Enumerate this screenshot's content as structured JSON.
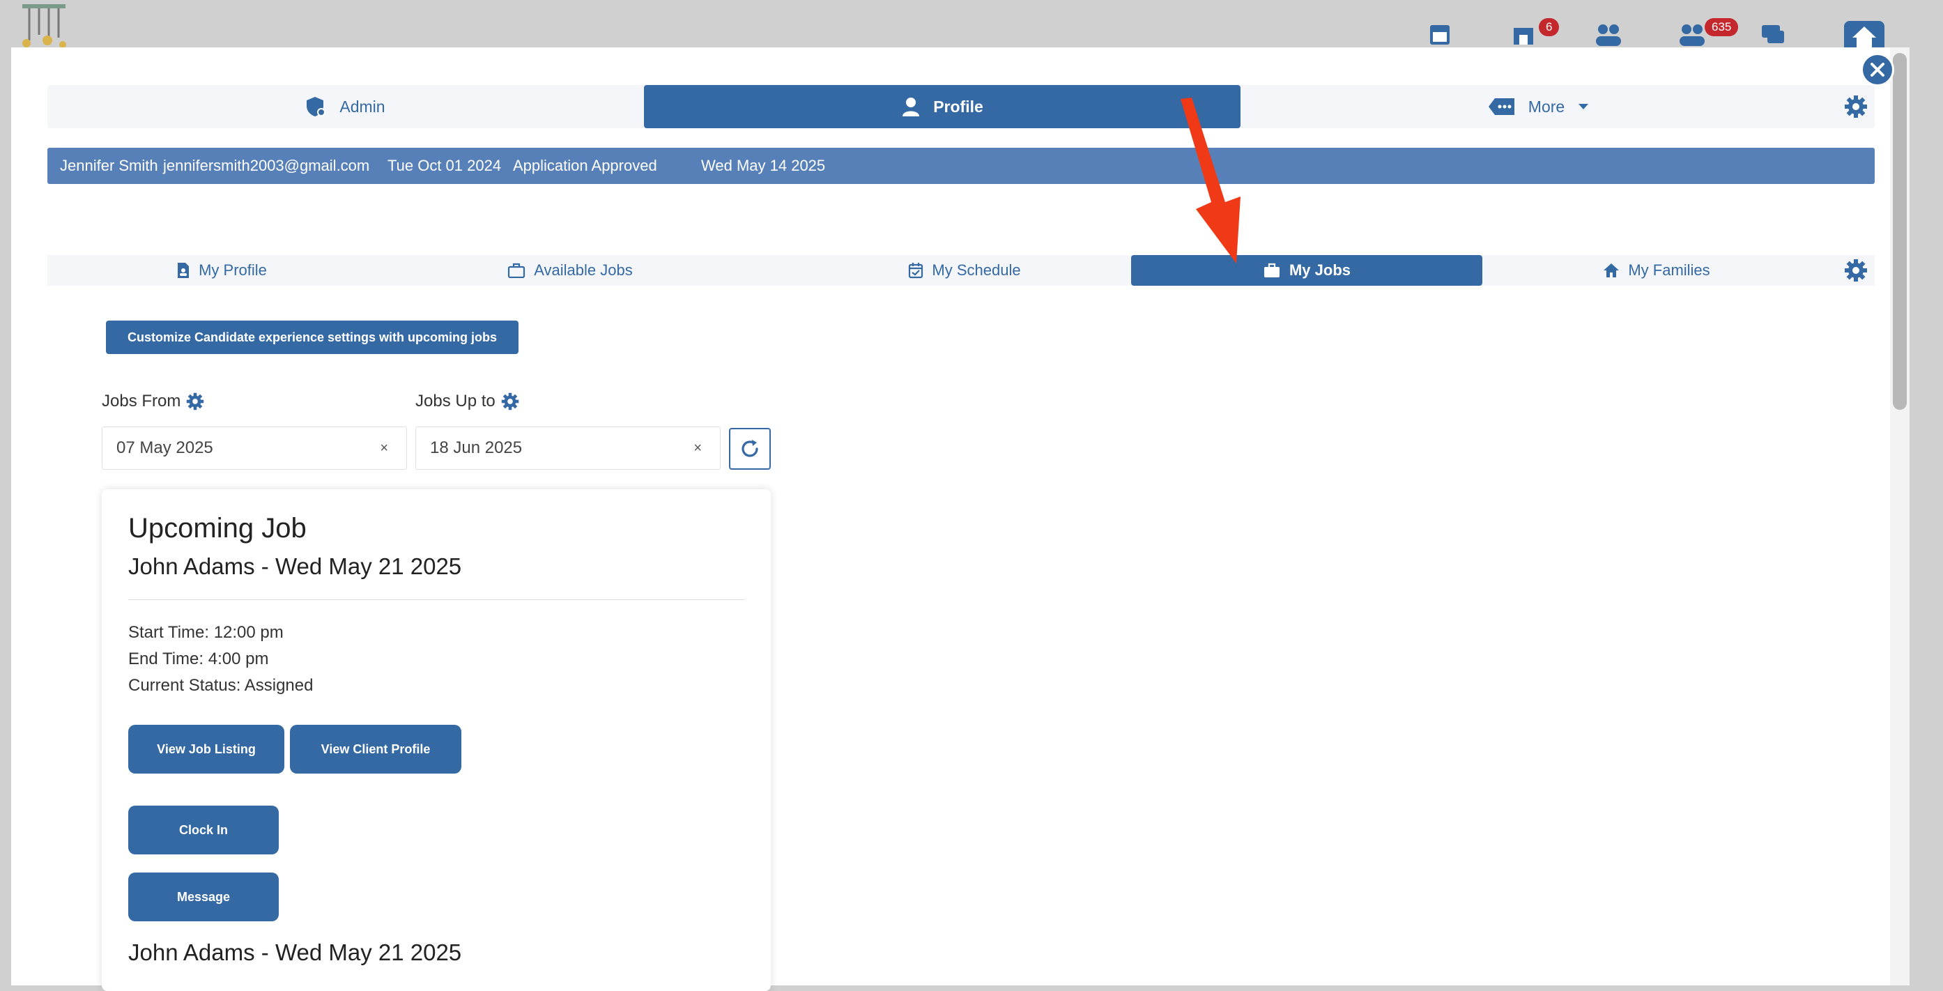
{
  "app_bar": {
    "badges": {
      "store": "6",
      "people": "635"
    }
  },
  "top_tabs": [
    {
      "label": "Admin",
      "icon": "shield-user-icon"
    },
    {
      "label": "Profile",
      "icon": "user-icon",
      "active": true
    },
    {
      "label": "More",
      "icon": "tag-more-icon"
    }
  ],
  "info_bar": {
    "name": "Jennifer Smith",
    "email": "jennifersmith2003@gmail.com",
    "date": "Tue Oct 01 2024",
    "status": "Application Approved",
    "date2": "Wed May 14 2025"
  },
  "sub_tabs": [
    {
      "label": "My Profile",
      "icon": "document-user-icon"
    },
    {
      "label": "Available Jobs",
      "icon": "briefcase-icon"
    },
    {
      "label": "My Schedule",
      "icon": "calendar-check-icon"
    },
    {
      "label": "My Jobs",
      "icon": "briefcase-icon",
      "active": true
    },
    {
      "label": "My Families",
      "icon": "home-icon"
    }
  ],
  "customize_button": "Customize Candidate experience settings with upcoming jobs",
  "filters": {
    "from_label": "Jobs From",
    "from_value": "07 May 2025",
    "to_label": "Jobs Up to",
    "to_value": "18 Jun 2025",
    "clear_glyph": "×"
  },
  "job_card": {
    "heading": "Upcoming Job",
    "subheading": "John Adams - Wed May 21 2025",
    "start": "Start Time: 12:00 pm",
    "end": "End Time: 4:00 pm",
    "status": "Current Status: Assigned",
    "view_listing": "View Job Listing",
    "view_client": "View Client Profile",
    "clock_in": "Clock In",
    "message": "Message",
    "next_subheading": "John Adams - Wed May 21 2025"
  },
  "colors": {
    "primary": "#3469a4",
    "banner": "#5680b7",
    "annotation_arrow": "#f03a17",
    "badge": "#c4282d"
  }
}
